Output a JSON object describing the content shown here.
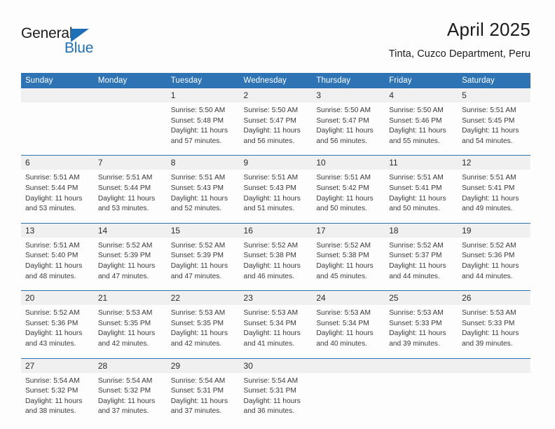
{
  "brand": {
    "name_part1": "General",
    "name_part2": "Blue",
    "triangle_icon": "blue-triangle-icon",
    "accent_color": "#1f6fb5"
  },
  "header": {
    "title": "April 2025",
    "location": "Tinta, Cuzco Department, Peru"
  },
  "calendar": {
    "header_color": "#2e74b5",
    "daynum_band_color": "#f0f0f0",
    "weekday_headers": [
      "Sunday",
      "Monday",
      "Tuesday",
      "Wednesday",
      "Thursday",
      "Friday",
      "Saturday"
    ],
    "weeks": [
      {
        "days": [
          {
            "num": "",
            "sunrise": "",
            "sunset": "",
            "daylight_line1": "",
            "daylight_line2": ""
          },
          {
            "num": "",
            "sunrise": "",
            "sunset": "",
            "daylight_line1": "",
            "daylight_line2": ""
          },
          {
            "num": "1",
            "sunrise": "Sunrise: 5:50 AM",
            "sunset": "Sunset: 5:48 PM",
            "daylight_line1": "Daylight: 11 hours",
            "daylight_line2": "and 57 minutes."
          },
          {
            "num": "2",
            "sunrise": "Sunrise: 5:50 AM",
            "sunset": "Sunset: 5:47 PM",
            "daylight_line1": "Daylight: 11 hours",
            "daylight_line2": "and 56 minutes."
          },
          {
            "num": "3",
            "sunrise": "Sunrise: 5:50 AM",
            "sunset": "Sunset: 5:47 PM",
            "daylight_line1": "Daylight: 11 hours",
            "daylight_line2": "and 56 minutes."
          },
          {
            "num": "4",
            "sunrise": "Sunrise: 5:50 AM",
            "sunset": "Sunset: 5:46 PM",
            "daylight_line1": "Daylight: 11 hours",
            "daylight_line2": "and 55 minutes."
          },
          {
            "num": "5",
            "sunrise": "Sunrise: 5:51 AM",
            "sunset": "Sunset: 5:45 PM",
            "daylight_line1": "Daylight: 11 hours",
            "daylight_line2": "and 54 minutes."
          }
        ]
      },
      {
        "days": [
          {
            "num": "6",
            "sunrise": "Sunrise: 5:51 AM",
            "sunset": "Sunset: 5:44 PM",
            "daylight_line1": "Daylight: 11 hours",
            "daylight_line2": "and 53 minutes."
          },
          {
            "num": "7",
            "sunrise": "Sunrise: 5:51 AM",
            "sunset": "Sunset: 5:44 PM",
            "daylight_line1": "Daylight: 11 hours",
            "daylight_line2": "and 53 minutes."
          },
          {
            "num": "8",
            "sunrise": "Sunrise: 5:51 AM",
            "sunset": "Sunset: 5:43 PM",
            "daylight_line1": "Daylight: 11 hours",
            "daylight_line2": "and 52 minutes."
          },
          {
            "num": "9",
            "sunrise": "Sunrise: 5:51 AM",
            "sunset": "Sunset: 5:43 PM",
            "daylight_line1": "Daylight: 11 hours",
            "daylight_line2": "and 51 minutes."
          },
          {
            "num": "10",
            "sunrise": "Sunrise: 5:51 AM",
            "sunset": "Sunset: 5:42 PM",
            "daylight_line1": "Daylight: 11 hours",
            "daylight_line2": "and 50 minutes."
          },
          {
            "num": "11",
            "sunrise": "Sunrise: 5:51 AM",
            "sunset": "Sunset: 5:41 PM",
            "daylight_line1": "Daylight: 11 hours",
            "daylight_line2": "and 50 minutes."
          },
          {
            "num": "12",
            "sunrise": "Sunrise: 5:51 AM",
            "sunset": "Sunset: 5:41 PM",
            "daylight_line1": "Daylight: 11 hours",
            "daylight_line2": "and 49 minutes."
          }
        ]
      },
      {
        "days": [
          {
            "num": "13",
            "sunrise": "Sunrise: 5:51 AM",
            "sunset": "Sunset: 5:40 PM",
            "daylight_line1": "Daylight: 11 hours",
            "daylight_line2": "and 48 minutes."
          },
          {
            "num": "14",
            "sunrise": "Sunrise: 5:52 AM",
            "sunset": "Sunset: 5:39 PM",
            "daylight_line1": "Daylight: 11 hours",
            "daylight_line2": "and 47 minutes."
          },
          {
            "num": "15",
            "sunrise": "Sunrise: 5:52 AM",
            "sunset": "Sunset: 5:39 PM",
            "daylight_line1": "Daylight: 11 hours",
            "daylight_line2": "and 47 minutes."
          },
          {
            "num": "16",
            "sunrise": "Sunrise: 5:52 AM",
            "sunset": "Sunset: 5:38 PM",
            "daylight_line1": "Daylight: 11 hours",
            "daylight_line2": "and 46 minutes."
          },
          {
            "num": "17",
            "sunrise": "Sunrise: 5:52 AM",
            "sunset": "Sunset: 5:38 PM",
            "daylight_line1": "Daylight: 11 hours",
            "daylight_line2": "and 45 minutes."
          },
          {
            "num": "18",
            "sunrise": "Sunrise: 5:52 AM",
            "sunset": "Sunset: 5:37 PM",
            "daylight_line1": "Daylight: 11 hours",
            "daylight_line2": "and 44 minutes."
          },
          {
            "num": "19",
            "sunrise": "Sunrise: 5:52 AM",
            "sunset": "Sunset: 5:36 PM",
            "daylight_line1": "Daylight: 11 hours",
            "daylight_line2": "and 44 minutes."
          }
        ]
      },
      {
        "days": [
          {
            "num": "20",
            "sunrise": "Sunrise: 5:52 AM",
            "sunset": "Sunset: 5:36 PM",
            "daylight_line1": "Daylight: 11 hours",
            "daylight_line2": "and 43 minutes."
          },
          {
            "num": "21",
            "sunrise": "Sunrise: 5:53 AM",
            "sunset": "Sunset: 5:35 PM",
            "daylight_line1": "Daylight: 11 hours",
            "daylight_line2": "and 42 minutes."
          },
          {
            "num": "22",
            "sunrise": "Sunrise: 5:53 AM",
            "sunset": "Sunset: 5:35 PM",
            "daylight_line1": "Daylight: 11 hours",
            "daylight_line2": "and 42 minutes."
          },
          {
            "num": "23",
            "sunrise": "Sunrise: 5:53 AM",
            "sunset": "Sunset: 5:34 PM",
            "daylight_line1": "Daylight: 11 hours",
            "daylight_line2": "and 41 minutes."
          },
          {
            "num": "24",
            "sunrise": "Sunrise: 5:53 AM",
            "sunset": "Sunset: 5:34 PM",
            "daylight_line1": "Daylight: 11 hours",
            "daylight_line2": "and 40 minutes."
          },
          {
            "num": "25",
            "sunrise": "Sunrise: 5:53 AM",
            "sunset": "Sunset: 5:33 PM",
            "daylight_line1": "Daylight: 11 hours",
            "daylight_line2": "and 39 minutes."
          },
          {
            "num": "26",
            "sunrise": "Sunrise: 5:53 AM",
            "sunset": "Sunset: 5:33 PM",
            "daylight_line1": "Daylight: 11 hours",
            "daylight_line2": "and 39 minutes."
          }
        ]
      },
      {
        "days": [
          {
            "num": "27",
            "sunrise": "Sunrise: 5:54 AM",
            "sunset": "Sunset: 5:32 PM",
            "daylight_line1": "Daylight: 11 hours",
            "daylight_line2": "and 38 minutes."
          },
          {
            "num": "28",
            "sunrise": "Sunrise: 5:54 AM",
            "sunset": "Sunset: 5:32 PM",
            "daylight_line1": "Daylight: 11 hours",
            "daylight_line2": "and 37 minutes."
          },
          {
            "num": "29",
            "sunrise": "Sunrise: 5:54 AM",
            "sunset": "Sunset: 5:31 PM",
            "daylight_line1": "Daylight: 11 hours",
            "daylight_line2": "and 37 minutes."
          },
          {
            "num": "30",
            "sunrise": "Sunrise: 5:54 AM",
            "sunset": "Sunset: 5:31 PM",
            "daylight_line1": "Daylight: 11 hours",
            "daylight_line2": "and 36 minutes."
          },
          {
            "num": "",
            "sunrise": "",
            "sunset": "",
            "daylight_line1": "",
            "daylight_line2": ""
          },
          {
            "num": "",
            "sunrise": "",
            "sunset": "",
            "daylight_line1": "",
            "daylight_line2": ""
          },
          {
            "num": "",
            "sunrise": "",
            "sunset": "",
            "daylight_line1": "",
            "daylight_line2": ""
          }
        ]
      }
    ]
  }
}
